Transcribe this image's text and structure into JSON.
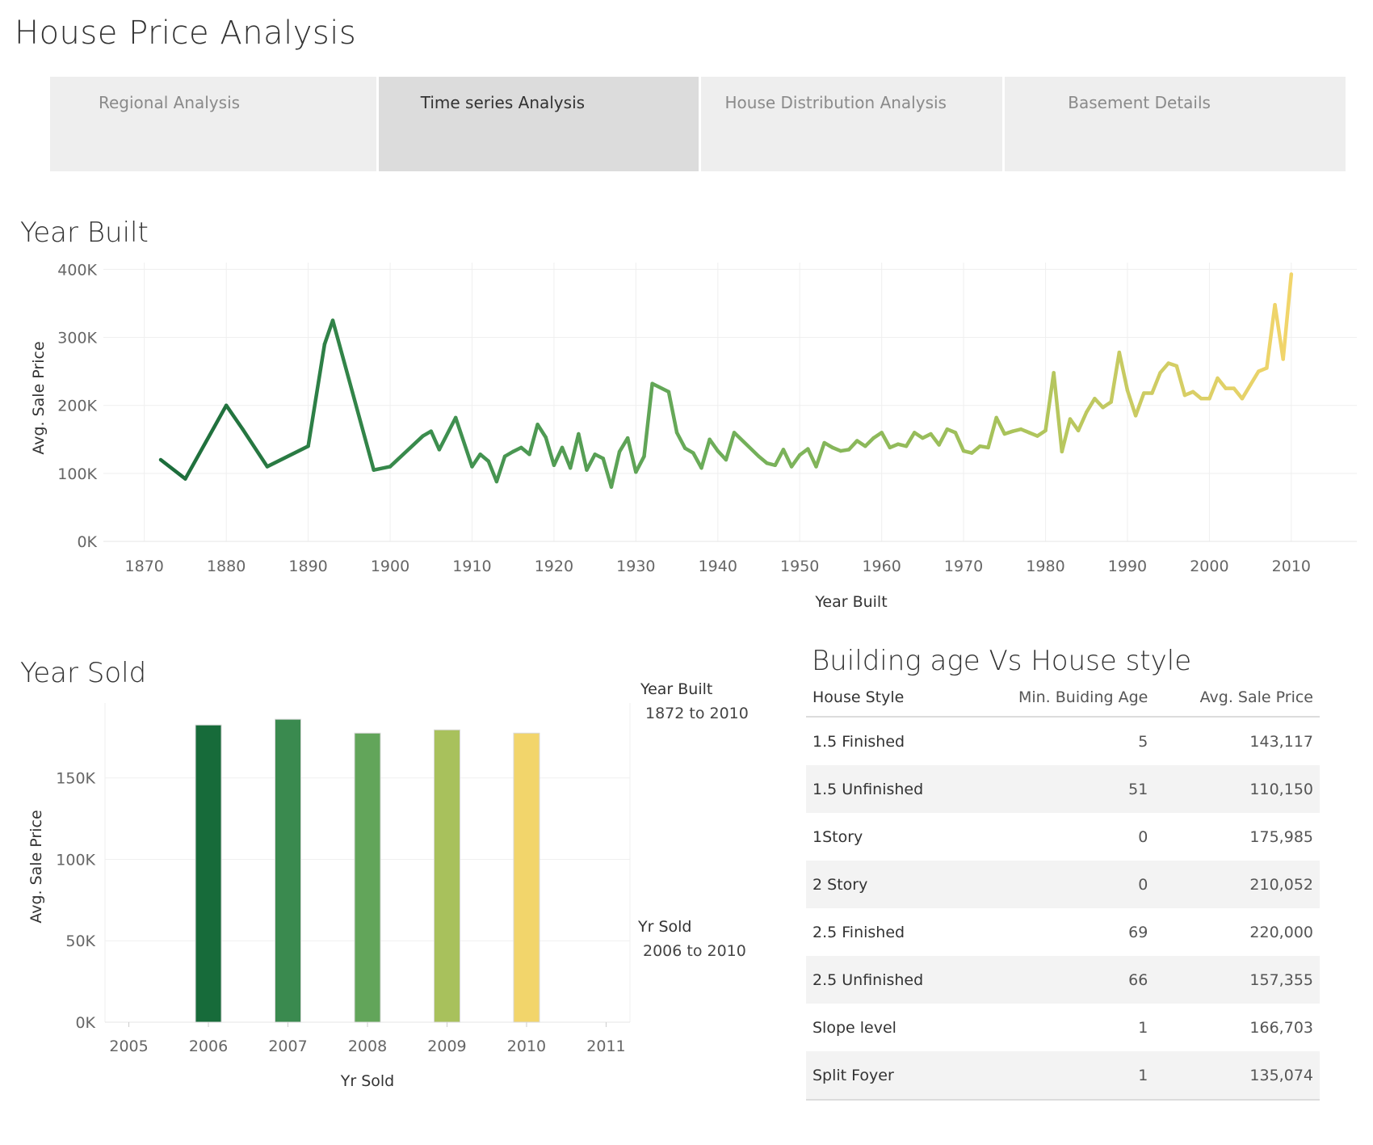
{
  "page_title": "House Price Analysis",
  "tabs": [
    {
      "label": "Regional Analysis",
      "active": false
    },
    {
      "label": "Time series Analysis",
      "active": true
    },
    {
      "label": "House Distribution Analysis",
      "active": false
    },
    {
      "label": "Basement Details",
      "active": false
    }
  ],
  "year_built_chart": {
    "title": "Year Built",
    "chart_data": {
      "type": "line",
      "xlabel": "Year Built",
      "ylabel": "Avg. Sale Price",
      "xlim": [
        1865,
        2018
      ],
      "ylim": [
        0,
        410000
      ],
      "x_ticks": [
        1870,
        1880,
        1890,
        1900,
        1910,
        1920,
        1930,
        1940,
        1950,
        1960,
        1970,
        1980,
        1990,
        2000,
        2010
      ],
      "y_ticks": [
        0,
        100000,
        200000,
        300000,
        400000
      ],
      "y_tick_labels": [
        "0K",
        "100K",
        "200K",
        "300K",
        "400K"
      ],
      "color_gradient": [
        "#1a6b3a",
        "#3d8f4f",
        "#6fae5a",
        "#a9c35b",
        "#f2d56b"
      ],
      "series": [
        {
          "x": [
            1872,
            1875,
            1880,
            1882,
            1885,
            1890,
            1892,
            1893,
            1898,
            1900,
            1904,
            1905,
            1906,
            1908,
            1910,
            1911,
            1912,
            1913,
            1914,
            1915,
            1916,
            1917,
            1918,
            1919,
            1920,
            1921,
            1922,
            1923,
            1924,
            1925,
            1926,
            1927,
            1928,
            1929,
            1930,
            1931,
            1932,
            1934,
            1935,
            1936,
            1937,
            1938,
            1939,
            1940,
            1941,
            1942,
            1945,
            1946,
            1947,
            1948,
            1949,
            1950,
            1951,
            1952,
            1953,
            1954,
            1955,
            1956,
            1957,
            1958,
            1959,
            1960,
            1961,
            1962,
            1963,
            1964,
            1965,
            1966,
            1967,
            1968,
            1969,
            1970,
            1971,
            1972,
            1973,
            1974,
            1975,
            1976,
            1977,
            1978,
            1979,
            1980,
            1981,
            1982,
            1983,
            1984,
            1985,
            1986,
            1987,
            1988,
            1989,
            1990,
            1991,
            1992,
            1993,
            1994,
            1995,
            1996,
            1997,
            1998,
            1999,
            2000,
            2001,
            2002,
            2003,
            2004,
            2005,
            2006,
            2007,
            2008,
            2009,
            2010
          ],
          "y": [
            120000,
            92000,
            200000,
            165000,
            110000,
            140000,
            290000,
            325000,
            105000,
            110000,
            155000,
            162000,
            135000,
            182000,
            110000,
            128000,
            118000,
            88000,
            125000,
            132000,
            138000,
            128000,
            172000,
            153000,
            112000,
            138000,
            108000,
            158000,
            105000,
            128000,
            122000,
            80000,
            132000,
            152000,
            102000,
            125000,
            232000,
            220000,
            160000,
            137000,
            130000,
            108000,
            150000,
            133000,
            120000,
            160000,
            125000,
            115000,
            112000,
            135000,
            110000,
            127000,
            136000,
            110000,
            145000,
            138000,
            133000,
            135000,
            148000,
            140000,
            152000,
            160000,
            138000,
            143000,
            140000,
            160000,
            152000,
            158000,
            142000,
            165000,
            160000,
            133000,
            130000,
            140000,
            138000,
            182000,
            158000,
            162000,
            165000,
            160000,
            155000,
            163000,
            248000,
            132000,
            180000,
            163000,
            190000,
            210000,
            197000,
            205000,
            278000,
            222000,
            185000,
            218000,
            218000,
            248000,
            262000,
            258000,
            215000,
            220000,
            210000,
            210000,
            240000,
            225000,
            225000,
            210000,
            230000,
            250000,
            255000,
            348000,
            268000,
            393000
          ]
        }
      ]
    }
  },
  "year_sold_chart": {
    "title": "Year Sold",
    "chart_data": {
      "type": "bar",
      "xlabel": "Yr Sold",
      "ylabel": "Avg. Sale Price",
      "x_ticks": [
        2005,
        2006,
        2007,
        2008,
        2009,
        2010,
        2011
      ],
      "categories": [
        2006,
        2007,
        2008,
        2009,
        2010
      ],
      "values": [
        182500,
        186000,
        177500,
        179500,
        177500
      ],
      "colors": [
        "#176b3a",
        "#3a8a4f",
        "#62a55a",
        "#a8c15c",
        "#f2d56b"
      ],
      "ylim": [
        0,
        196000
      ],
      "y_ticks": [
        0,
        50000,
        100000,
        150000
      ],
      "y_tick_labels": [
        "0K",
        "50K",
        "100K",
        "150K"
      ]
    }
  },
  "legends": {
    "year_built": {
      "label": "Year Built",
      "range": "1872 to 2010"
    },
    "yr_sold": {
      "label": "Yr Sold",
      "range": "2006 to 2010"
    }
  },
  "house_style_table": {
    "title": "Building age Vs House style",
    "columns": [
      "House Style",
      "Min. Buiding Age",
      "Avg. Sale Price"
    ],
    "rows": [
      [
        "1.5 Finished",
        "5",
        "143,117"
      ],
      [
        "1.5 Unfinished",
        "51",
        "110,150"
      ],
      [
        "1Story",
        "0",
        "175,985"
      ],
      [
        "2 Story",
        "0",
        "210,052"
      ],
      [
        "2.5 Finished",
        "69",
        "220,000"
      ],
      [
        "2.5 Unfinished",
        "66",
        "157,355"
      ],
      [
        "Slope level",
        "1",
        "166,703"
      ],
      [
        "Split Foyer",
        "1",
        "135,074"
      ]
    ]
  }
}
